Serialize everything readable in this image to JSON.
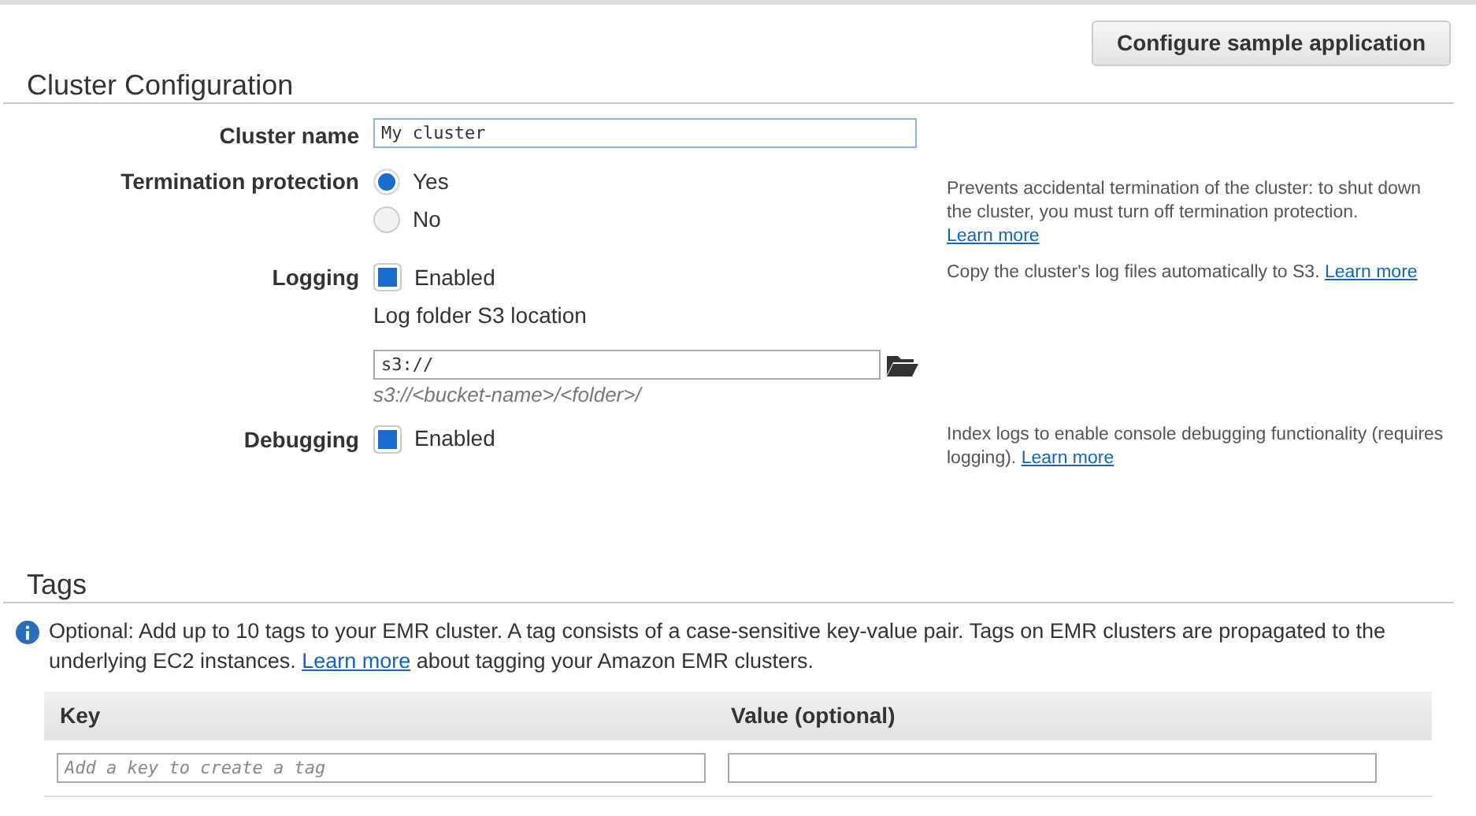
{
  "header_button": "Configure sample application",
  "section": {
    "title": "Cluster Configuration",
    "rows": [
      {
        "kind": "text",
        "label": "Cluster name",
        "value": "My cluster",
        "focused": true
      },
      {
        "kind": "radio",
        "label": "Termination protection",
        "options": [
          {
            "label": "Yes",
            "selected": true
          },
          {
            "label": "No",
            "selected": false
          }
        ],
        "help": "Prevents accidental termination of the cluster: to shut down the cluster, you must turn off termination protection.",
        "help_link": "Learn more"
      },
      {
        "kind": "checkbox",
        "label": "Logging",
        "option": "Enabled",
        "checked": true,
        "help": "Copy the cluster's log files automatically to S3.",
        "help_link": "Learn more",
        "sub": {
          "label": "Log folder S3 location",
          "value": "s3://",
          "hint": "s3://<bucket-name>/<folder>/"
        }
      },
      {
        "kind": "checkbox",
        "label": "Debugging",
        "option": "Enabled",
        "checked": true,
        "help": "Index logs to enable console debugging functionality (requires logging).",
        "help_link": "Learn more"
      }
    ]
  },
  "tags": {
    "title": "Tags",
    "info_before": "Optional: Add up to 10 tags to your EMR cluster. A tag consists of a case-sensitive key-value pair. Tags on EMR clusters are propagated to the underlying EC2 instances.",
    "info_link": "Learn more",
    "info_after": "about tagging your Amazon EMR clusters.",
    "columns": [
      "Key",
      "Value (optional)"
    ],
    "rows": [
      {
        "key_placeholder": "Add a key to create a tag"
      }
    ]
  }
}
